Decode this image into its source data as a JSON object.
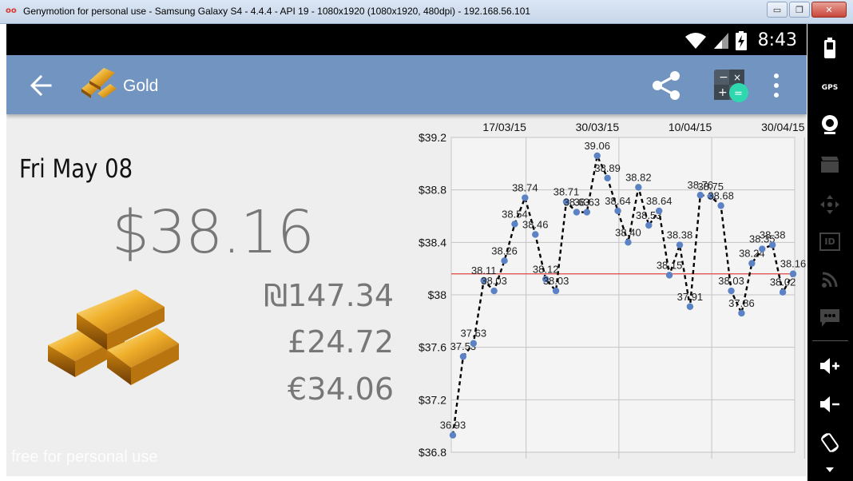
{
  "window": {
    "logo": "oo",
    "title": "Genymotion for personal use - Samsung Galaxy S4 - 4.4.4 - API 19 - 1080x1920 (1080x1920, 480dpi) - 192.168.56.101",
    "buttons": {
      "minimize": "▭",
      "restore": "❐",
      "close": "✕"
    }
  },
  "status_bar": {
    "time": "8:43",
    "icons": [
      "wifi-icon",
      "signal-icon",
      "battery-charging-icon"
    ]
  },
  "action_bar": {
    "title": "Gold",
    "icons": [
      "back-arrow-icon",
      "gold-bars-icon",
      "share-icon",
      "calculator-icon",
      "more-vert-icon"
    ]
  },
  "prices": {
    "date": "Fri May 08",
    "usd": "$38.16",
    "ils": "₪147.34",
    "gbp": "£24.72",
    "eur": "€34.06"
  },
  "watermark": "free for personal use",
  "sidebar": {
    "gps_label": "GPS",
    "id_label": "ID",
    "icons": [
      "battery-icon",
      "gps-icon",
      "webcam-icon",
      "video-capture-icon",
      "dpad-icon",
      "id-icon",
      "rss-icon",
      "sms-icon",
      "volume-up-icon",
      "volume-down-icon",
      "rotate-icon"
    ]
  },
  "colors": {
    "action_bar": "#7294c1",
    "screen_bg": "#eeeeee",
    "point": "#5b82c4",
    "reference_line": "#e04444"
  },
  "chart_data": {
    "type": "line",
    "top_ticks": [
      "17/03/15",
      "30/03/15",
      "10/04/15",
      "30/04/15"
    ],
    "y_ticks": [
      "$39.2",
      "$38.8",
      "$38.4",
      "$38",
      "$37.6",
      "$37.2",
      "$36.8"
    ],
    "ylim": [
      36.8,
      39.2
    ],
    "reference_line": 38.16,
    "grid": true,
    "series": [
      {
        "values": [
          36.93,
          37.53,
          37.63,
          38.11,
          38.03,
          38.26,
          38.54,
          38.74,
          38.46,
          38.12,
          38.03,
          38.71,
          38.63,
          38.63,
          39.06,
          38.89,
          38.64,
          38.4,
          38.82,
          38.53,
          38.64,
          38.15,
          38.38,
          37.91,
          38.76,
          38.75,
          38.68,
          38.03,
          37.86,
          38.24,
          38.35,
          38.38,
          38.02,
          38.16
        ],
        "labels": [
          "36.93",
          "37.53",
          "37.63",
          "38.11",
          "38.03",
          "38.26",
          "38.54",
          "38.74",
          "38.46",
          "38.12",
          "38.03",
          "38.71",
          "38.63",
          "38.63",
          "39.06",
          "38.89",
          "38.64",
          "38.40",
          "38.82",
          "38.53",
          "38.64",
          "38.15",
          "38.38",
          "37.91",
          "38.76",
          "38.75",
          "38.68",
          "38.03",
          "37.86",
          "38.24",
          "38.35",
          "38.38",
          "38.02",
          "38.16"
        ]
      }
    ]
  }
}
